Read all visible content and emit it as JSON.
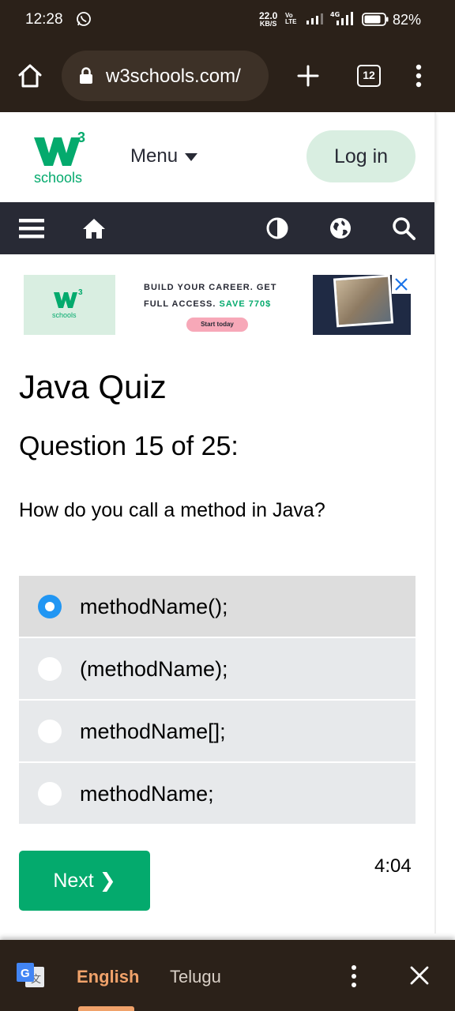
{
  "status_bar": {
    "time": "12:28",
    "net_speed_value": "22.0",
    "net_speed_unit": "KB/S",
    "volte_top": "Vo",
    "volte_bottom": "LTE",
    "network_type": "4G",
    "battery": "82%",
    "icons": [
      "whatsapp-icon",
      "signal-icon",
      "4g-signal-icon",
      "battery-icon"
    ]
  },
  "browser": {
    "url": "w3schools.com/",
    "tab_count": "12",
    "icons": [
      "home-icon",
      "lock-icon",
      "plus-icon",
      "more-vert-icon"
    ]
  },
  "site_header": {
    "logo_superscript": "3",
    "logo_text": "schools",
    "menu_label": "Menu",
    "login_label": "Log in",
    "accent_color": "#04aa6d",
    "login_bg": "#d9eee1"
  },
  "site_nav": {
    "background": "#282a35",
    "icons": [
      "hamburger-icon",
      "home-icon",
      "contrast-icon",
      "globe-icon",
      "search-icon"
    ]
  },
  "ad": {
    "logo_superscript": "3",
    "logo_text": "schools",
    "line1": "BUILD YOUR CAREER. GET",
    "line2_prefix": "FULL ACCESS.",
    "line2_highlight": "SAVE 770$",
    "cta": "Start today"
  },
  "quiz": {
    "title": "Java Quiz",
    "question_number": "Question 15 of 25:",
    "question_text": "How do you call a method in Java?",
    "options": [
      {
        "label": "methodName();",
        "selected": true
      },
      {
        "label": "(methodName);",
        "selected": false
      },
      {
        "label": "methodName[];",
        "selected": false
      },
      {
        "label": "methodName;",
        "selected": false
      }
    ],
    "next_label": "Next ❯",
    "timer": "4:04"
  },
  "translate_bar": {
    "source_lang": "English",
    "target_lang": "Telugu",
    "active_color": "#f0a26a",
    "icons": [
      "google-translate-icon",
      "more-vert-icon",
      "close-icon"
    ]
  }
}
